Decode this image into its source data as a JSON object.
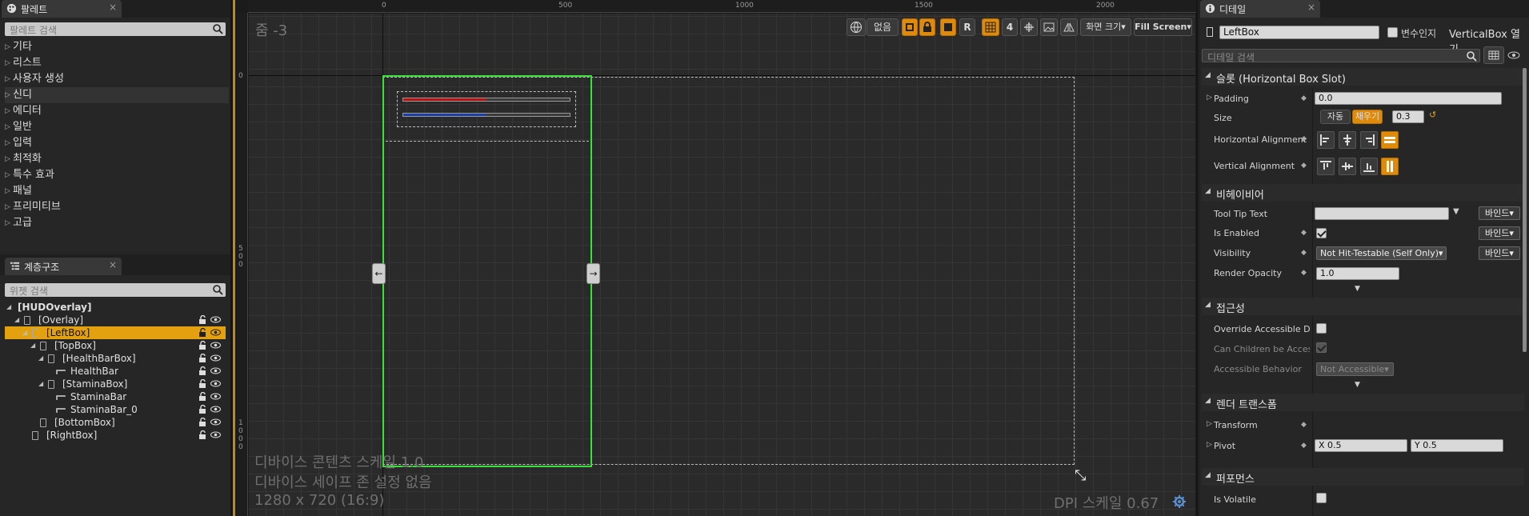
{
  "palette": {
    "tab_title": "팔레트",
    "search_placeholder": "팔레트 검색",
    "categories": [
      "기타",
      "리스트",
      "사용자 생성",
      "신디",
      "에디터",
      "일반",
      "입력",
      "최적화",
      "특수 효과",
      "패널",
      "프리미티브",
      "고급"
    ]
  },
  "hierarchy": {
    "tab_title": "계층구조",
    "search_placeholder": "위젯 검색",
    "items": [
      "[HUDOverlay]",
      "[Overlay]",
      "[LeftBox]",
      "[TopBox]",
      "[HealthBarBox]",
      "HealthBar",
      "[StaminaBox]",
      "StaminaBar",
      "StaminaBar_0",
      "[BottomBox]",
      "[RightBox]"
    ]
  },
  "designer": {
    "zoom_label": "줌 -3",
    "ruler_x": [
      "0",
      "500",
      "1000",
      "1500",
      "2000"
    ],
    "ruler_y": [
      [
        "0"
      ],
      [
        "5",
        "0",
        "0"
      ],
      [
        "1",
        "0",
        "0",
        "0"
      ]
    ],
    "toolbar": {
      "none_label": "없음",
      "r_label": "R",
      "grid_value": "4",
      "screen_size_label": "화면 크기▾",
      "fill_screen_label": "Fill Screen▾"
    },
    "overlay": {
      "line1": "디바이스 콘텐츠 스케일 1.0",
      "line2": "디바이스 세이프 존 설정 없음",
      "line3": "1280 x 720 (16:9)"
    },
    "dpi_label": "DPI 스케일 0.67",
    "left_arrow": "←",
    "right_arrow": "→",
    "health_color": "#b81010",
    "stamina_color": "#1a3ea8",
    "selection_color": "#39e139"
  },
  "details": {
    "tab_title": "디테일",
    "widget_name": "LeftBox",
    "is_variable_label": "변수인지",
    "open_label": "VerticalBox 열기",
    "search_placeholder": "디테일 검색",
    "slot_section": "슬롯 (Horizontal Box Slot)",
    "padding_label": "Padding",
    "padding_value": "0.0",
    "size_label": "Size",
    "size_auto": "자동",
    "size_fill": "채우기",
    "size_value": "0.3",
    "halign_label": "Horizontal Alignment",
    "valign_label": "Vertical Alignment",
    "behavior_section": "비헤이비어",
    "tooltip_label": "Tool Tip Text",
    "enabled_label": "Is Enabled",
    "visibility_label": "Visibility",
    "visibility_value": "Not Hit-Testable (Self Only)▾",
    "opacity_label": "Render Opacity",
    "opacity_value": "1.0",
    "bind_label": "바인드▾",
    "access_section": "접근성",
    "override_label": "Override Accessible Defa",
    "children_label": "Can Children be Accessib",
    "behavior_label": "Accessible Behavior",
    "behavior_value": "Not Accessible▾",
    "render_section": "렌더 트랜스폼",
    "transform_label": "Transform",
    "pivot_label": "Pivot",
    "pivot_x": "X  0.5",
    "pivot_y": "Y  0.5",
    "perf_section": "퍼포먼스",
    "volatile_label": "Is Volatile"
  },
  "colors": {
    "accent": "#e4a10f",
    "panel": "#242424",
    "canvas": "#2a2a2a"
  }
}
